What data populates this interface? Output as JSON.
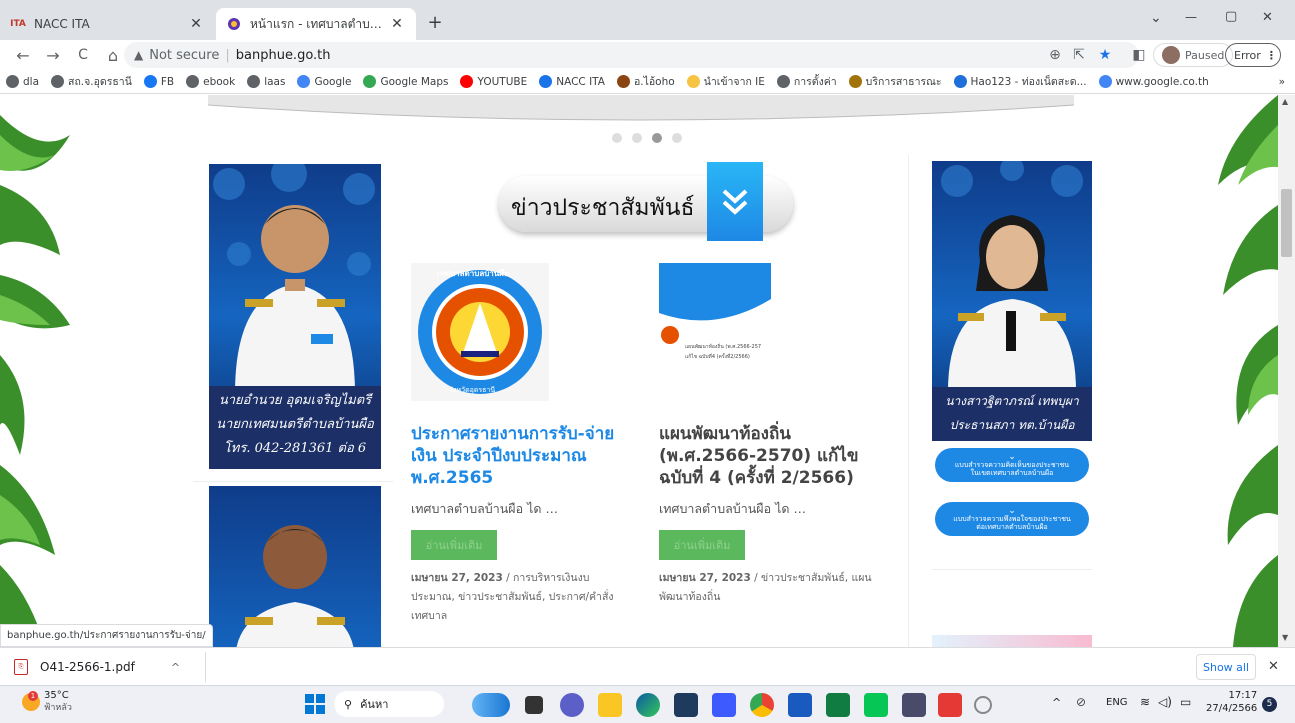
{
  "tabs": [
    {
      "icon": "ITA",
      "title": "NACC ITA",
      "active": false
    },
    {
      "icon": "",
      "title": "หน้าแรก - เทศบาลตำบลบ้านผือ อำเภ",
      "active": true
    }
  ],
  "window_controls": {
    "minimize": "—",
    "restore": "▢",
    "close": "✕",
    "chevron": "⌄"
  },
  "toolbar": {
    "back": "←",
    "forward": "→",
    "reload": "C",
    "home": "⌂"
  },
  "omnibox": {
    "security": "Not secure",
    "url": "banphue.go.th"
  },
  "profile": {
    "paused": "Paused",
    "error": "Error"
  },
  "bookmarks": [
    {
      "icon": "globe",
      "label": "dla",
      "color": "#5f6368"
    },
    {
      "icon": "globe",
      "label": "สถ.จ.อุดรธานี",
      "color": "#5f6368"
    },
    {
      "icon": "facebook",
      "label": "FB",
      "color": "#1877f2"
    },
    {
      "icon": "globe",
      "label": "ebook",
      "color": "#5f6368"
    },
    {
      "icon": "globe",
      "label": "laas",
      "color": "#5f6368"
    },
    {
      "icon": "google",
      "label": "Google",
      "color": "#4285f4"
    },
    {
      "icon": "maps",
      "label": "Google Maps",
      "color": "#34a853"
    },
    {
      "icon": "youtube",
      "label": "YOUTUBE",
      "color": "#ff0000"
    },
    {
      "icon": "ITA",
      "label": "NACC ITA",
      "color": "#1a73e8"
    },
    {
      "icon": "globe",
      "label": "อ.ไอ้oho",
      "color": "#8b4513"
    },
    {
      "icon": "folder",
      "label": "นำเข้าจาก IE",
      "color": "#f6c343"
    },
    {
      "icon": "gear",
      "label": "การตั้งค่า",
      "color": "#5f6368"
    },
    {
      "icon": "globe",
      "label": "บริการสาธารณะ",
      "color": "#a0740a"
    },
    {
      "icon": "hao",
      "label": "Hao123 - ท่องเน็ตสะด...",
      "color": "#1e6fd9"
    },
    {
      "icon": "google",
      "label": "www.google.co.th",
      "color": "#4285f4"
    }
  ],
  "bookmarks_more": "»",
  "page": {
    "banner": "ข่าวประชาสัมพันธ์",
    "left_person": {
      "caption": [
        "นายอำนวย อุดมเจริญไมตรี",
        "นายกเทศมนตรีตำบลบ้านผือ",
        "โทร. 042-281361 ต่อ 6"
      ]
    },
    "right_person": {
      "caption": [
        "นางสาวฐิตาภรณ์ เทพบุผา",
        "ประธานสภา ทต.บ้านผือ"
      ]
    },
    "side_buttons": [
      "แบบสำรวจความคิดเห็นของประชาชน ในเขตเทศบาลตำบลบ้านผือ",
      "แบบสำรวจความพึงพอใจของประชาชน ต่อเทศบาลตำบลบ้านผือ"
    ],
    "logo_text": "เทศบาลตำบลบ้านผือ",
    "logo_sub": "จังหวัดอุดรธานี",
    "doc_thumb_text": [
      "แผนพัฒนาท้องถิ่น (พ.ศ.2566-257",
      "แก้ไข ฉบับที่4 (ครั้งที่2/2566)"
    ],
    "posts": [
      {
        "title": "ประกาศรายงานการรับ-จ่ายเงิน ประจำปีงบประมาณ พ.ศ.2565",
        "excerpt": "เทศบาลตำบลบ้านผือ ได …",
        "readmore": "อ่านเพิ่มเติม",
        "date": "เมษายน 27, 2023",
        "cats": "/ การบริหารเงินงบประมาณ, ข่าวประชาสัมพันธ์, ประกาศ/คำสั่งเทศบาล",
        "color": "#1e88e5"
      },
      {
        "title": "แผนพัฒนาท้องถิ่น (พ.ศ.2566-2570) แก้ไขฉบับที่ 4 (ครั้งที่ 2/2566)",
        "excerpt": "เทศบาลตำบลบ้านผือ ได …",
        "readmore": "อ่านเพิ่มเติม",
        "date": "เมษายน 27, 2023",
        "cats": "/ ข่าวประชาสัมพันธ์, แผนพัฒนาท้องถิ่น",
        "color": "#444444"
      }
    ]
  },
  "status_url": "banphue.go.th/ประกาศรายงานการรับ-จ่าย/",
  "download": {
    "file": "O41-2566-1.pdf",
    "show_all": "Show all"
  },
  "taskbar": {
    "weather": {
      "temp": "35°C",
      "desc": "ฟ้าหลัว"
    },
    "search": "ค้นหา",
    "tray": {
      "lang": "ENG",
      "time": "17:17",
      "date": "27/4/2566",
      "badge": "5"
    }
  }
}
